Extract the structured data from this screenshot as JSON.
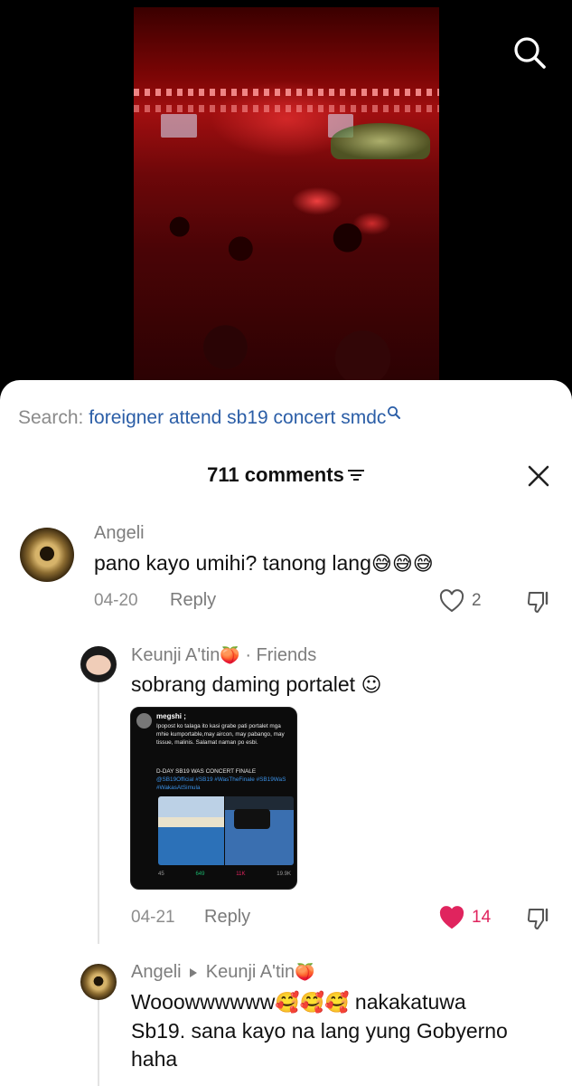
{
  "search": {
    "prefix": "Search:",
    "term": "foreigner attend sb19 concert smdc"
  },
  "comments": {
    "header": "711 comments",
    "items": [
      {
        "username": "Angeli",
        "text": "pano kayo umihi? tanong lang",
        "emojis": "😅😅😅",
        "date": "04-20",
        "reply_label": "Reply",
        "likes": "2"
      },
      {
        "username": "Keunji A'tin",
        "user_emoji": "🍑",
        "relation": "· Friends",
        "text": "sobrang daming portalet",
        "emojis": "☺",
        "date": "04-21",
        "reply_label": "Reply",
        "likes": "14",
        "embed": {
          "name": "megshi ;",
          "body": "Ipopost ko talaga ito kasi grabe pati portalet mga mhie kumportable,may aircon, may pabango, may tissue, malinis. Salamat naman po esbi.",
          "tags_line1": "D-DAY SB19 WAS CONCERT FINALE",
          "tags_line2": "@SB19Official #SB19 #WasTheFinale #SB19WaS #WakasAtSimula",
          "stat_replies": "45",
          "stat_reposts": "649",
          "stat_likes": "11K",
          "stat_views": "19.9K"
        }
      },
      {
        "username": "Angeli",
        "reply_to": "Keunji A'tin",
        "reply_to_emoji": "🍑",
        "text_line1": "Wooowwwwww",
        "emojis": "🥰🥰🥰",
        "text_line1_rest": "nakakatuwa",
        "text_line2": "Sb19. sana kayo na lang yung Gobyerno",
        "text_line3": "haha"
      }
    ]
  },
  "colors": {
    "accent_blue": "#2b5ea7",
    "like_red": "#e0245e"
  },
  "icons": [
    "search-icon",
    "filter-icon",
    "close-icon",
    "heart-icon",
    "dislike-icon",
    "reply-arrow-icon"
  ]
}
